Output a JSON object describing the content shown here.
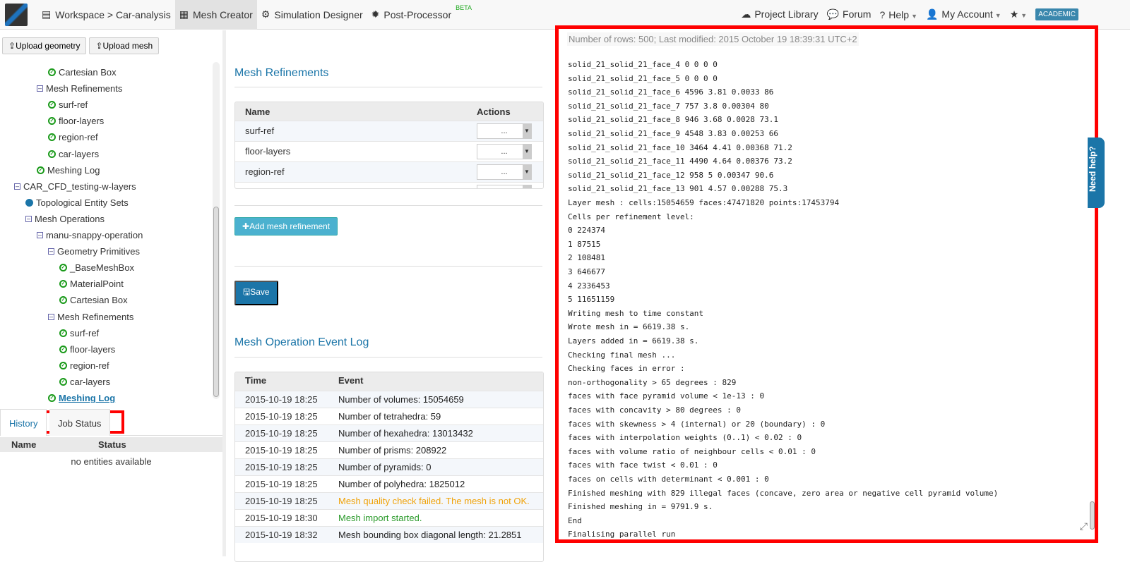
{
  "nav": {
    "workspace": "Workspace > Car-analysis",
    "mesh_creator": "Mesh Creator",
    "simulation_designer": "Simulation Designer",
    "post_processor": "Post-Processor",
    "beta": "BETA",
    "project_library": "Project Library",
    "forum": "Forum",
    "help": "Help",
    "my_account": "My Account",
    "academic": "ACADEMIC"
  },
  "left": {
    "upload_geometry": "Upload geometry",
    "upload_mesh": "Upload mesh",
    "tree": [
      {
        "label": "Cartesian Box",
        "type": "check",
        "level": 3
      },
      {
        "label": "Mesh Refinements",
        "type": "minus",
        "level": 2
      },
      {
        "label": "surf-ref",
        "type": "check",
        "level": 3
      },
      {
        "label": "floor-layers",
        "type": "check",
        "level": 3
      },
      {
        "label": "region-ref",
        "type": "check",
        "level": 3
      },
      {
        "label": "car-layers",
        "type": "check",
        "level": 3
      },
      {
        "label": "Meshing Log",
        "type": "check",
        "level": 2
      },
      {
        "label": "CAR_CFD_testing-w-layers",
        "type": "minus",
        "level": 0
      },
      {
        "label": "Topological Entity Sets",
        "type": "dot",
        "level": 1
      },
      {
        "label": "Mesh Operations",
        "type": "minus",
        "level": 1
      },
      {
        "label": "manu-snappy-operation",
        "type": "minus",
        "level": 2
      },
      {
        "label": "Geometry Primitives",
        "type": "minus",
        "level": 3
      },
      {
        "label": "_BaseMeshBox",
        "type": "check",
        "level": 4
      },
      {
        "label": "MaterialPoint",
        "type": "check",
        "level": 4
      },
      {
        "label": "Cartesian Box",
        "type": "check",
        "level": 4
      },
      {
        "label": "Mesh Refinements",
        "type": "minus",
        "level": 3
      },
      {
        "label": "surf-ref",
        "type": "check",
        "level": 4
      },
      {
        "label": "floor-layers",
        "type": "check",
        "level": 4
      },
      {
        "label": "region-ref",
        "type": "check",
        "level": 4
      },
      {
        "label": "car-layers",
        "type": "check",
        "level": 4
      },
      {
        "label": "Meshing Log",
        "type": "check",
        "level": 3,
        "selected": true
      }
    ],
    "tabs": [
      "History",
      "Job Status"
    ],
    "job_cols": [
      "Name",
      "Status"
    ],
    "job_empty": "no entities available"
  },
  "mesh_refinements": {
    "title": "Mesh Refinements",
    "cols": [
      "Name",
      "Actions"
    ],
    "rows": [
      "surf-ref",
      "floor-layers",
      "region-ref"
    ],
    "action_value": "...",
    "add_label": "Add mesh refinement",
    "save_label": "Save"
  },
  "event_log": {
    "title": "Mesh Operation Event Log",
    "cols": [
      "Time",
      "Event"
    ],
    "rows": [
      {
        "time": "2015-10-19 18:25",
        "event": "Number of volumes: 15054659",
        "status": "normal"
      },
      {
        "time": "2015-10-19 18:25",
        "event": "Number of tetrahedra: 59",
        "status": "normal"
      },
      {
        "time": "2015-10-19 18:25",
        "event": "Number of hexahedra: 13013432",
        "status": "normal"
      },
      {
        "time": "2015-10-19 18:25",
        "event": "Number of prisms: 208922",
        "status": "normal"
      },
      {
        "time": "2015-10-19 18:25",
        "event": "Number of pyramids: 0",
        "status": "normal"
      },
      {
        "time": "2015-10-19 18:25",
        "event": "Number of polyhedra: 1825012",
        "status": "normal"
      },
      {
        "time": "2015-10-19 18:25",
        "event": "Mesh quality check failed. The mesh is not OK.",
        "status": "warning"
      },
      {
        "time": "2015-10-19 18:30",
        "event": "Mesh import started.",
        "status": "success"
      },
      {
        "time": "2015-10-19 18:32",
        "event": "Mesh bounding box diagonal length: 21.2851",
        "status": "normal"
      }
    ],
    "colors": {
      "warning": "#f0a30a",
      "success": "#2a9a2a",
      "normal": "#222"
    }
  },
  "log": {
    "header": "Number of rows: 500; Last modified: 2015 October 19 18:39:31 UTC+2",
    "lines": [
      "solid_21_solid_21_face_4 0 0 0 0",
      "solid_21_solid_21_face_5 0 0 0 0",
      "solid_21_solid_21_face_6 4596 3.81 0.0033 86",
      "solid_21_solid_21_face_7 757 3.8 0.00304 80",
      "solid_21_solid_21_face_8 946 3.68 0.0028 73.1",
      "solid_21_solid_21_face_9 4548 3.83 0.00253 66",
      "solid_21_solid_21_face_10 3464 4.41 0.00368 71.2",
      "solid_21_solid_21_face_11 4490 4.64 0.00376 73.2",
      "solid_21_solid_21_face_12 958 5 0.00347 90.6",
      "solid_21_solid_21_face_13 901 4.57 0.00288 75.3",
      "Layer mesh : cells:15054659 faces:47471820 points:17453794",
      "Cells per refinement level:",
      "0 224374",
      "1 87515",
      "2 108481",
      "3 646677",
      "4 2336453",
      "5 11651159",
      "Writing mesh to time constant",
      "Wrote mesh in = 6619.38 s.",
      "Layers added in = 6619.38 s.",
      "Checking final mesh ...",
      "Checking faces in error :",
      "non-orthogonality > 65 degrees : 829",
      "faces with face pyramid volume < 1e-13 : 0",
      "faces with concavity > 80 degrees : 0",
      "faces with skewness > 4 (internal) or 20 (boundary) : 0",
      "faces with interpolation weights (0..1) < 0.02 : 0",
      "faces with volume ratio of neighbour cells < 0.01 : 0",
      "faces with face twist < 0.01 : 0",
      "faces on cells with determinant < 0.001 : 0",
      "Finished meshing with 829 illegal faces (concave, zero area or negative cell pyramid volume)",
      "Finished meshing in = 9791.9 s.",
      "End",
      "Finalising parallel run"
    ]
  },
  "need_help": "Need help?"
}
